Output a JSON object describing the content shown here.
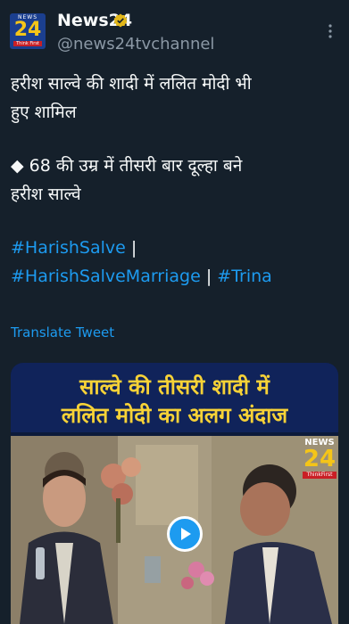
{
  "account": {
    "avatar_top": "NEWS",
    "avatar_number": "24",
    "avatar_bottom": "Think First",
    "name": "News24",
    "handle": "@news24tvchannel",
    "verified_icon": "verified-badge-icon",
    "more_icon": "more-options-icon"
  },
  "tweet": {
    "line1": "हरीश साल्वे की शादी में ललित मोदी भी",
    "line2": "हुए शामिल",
    "line3": "◆ 68 की उम्र में तीसरी बार दूल्हा बने",
    "line4": "हरीश साल्वे",
    "hashtag1": "#HarishSalve",
    "sep1": " |",
    "hashtag2": "#HarishSalveMarriage",
    "sep2": " | ",
    "hashtag3": "#Trina",
    "translate": "Translate Tweet"
  },
  "media": {
    "title_line1": "साल्वे की तीसरी शादी में",
    "title_line2": "ललित मोदी का अलग अंदाज",
    "logo_news": "NEWS",
    "logo_number": "24",
    "logo_tagline": "ThinkFirst",
    "play_icon": "play-button-icon"
  },
  "colors": {
    "background": "#15202b",
    "link": "#1d9bf0",
    "title_yellow": "#f7d237",
    "muted": "#8b98a5"
  }
}
